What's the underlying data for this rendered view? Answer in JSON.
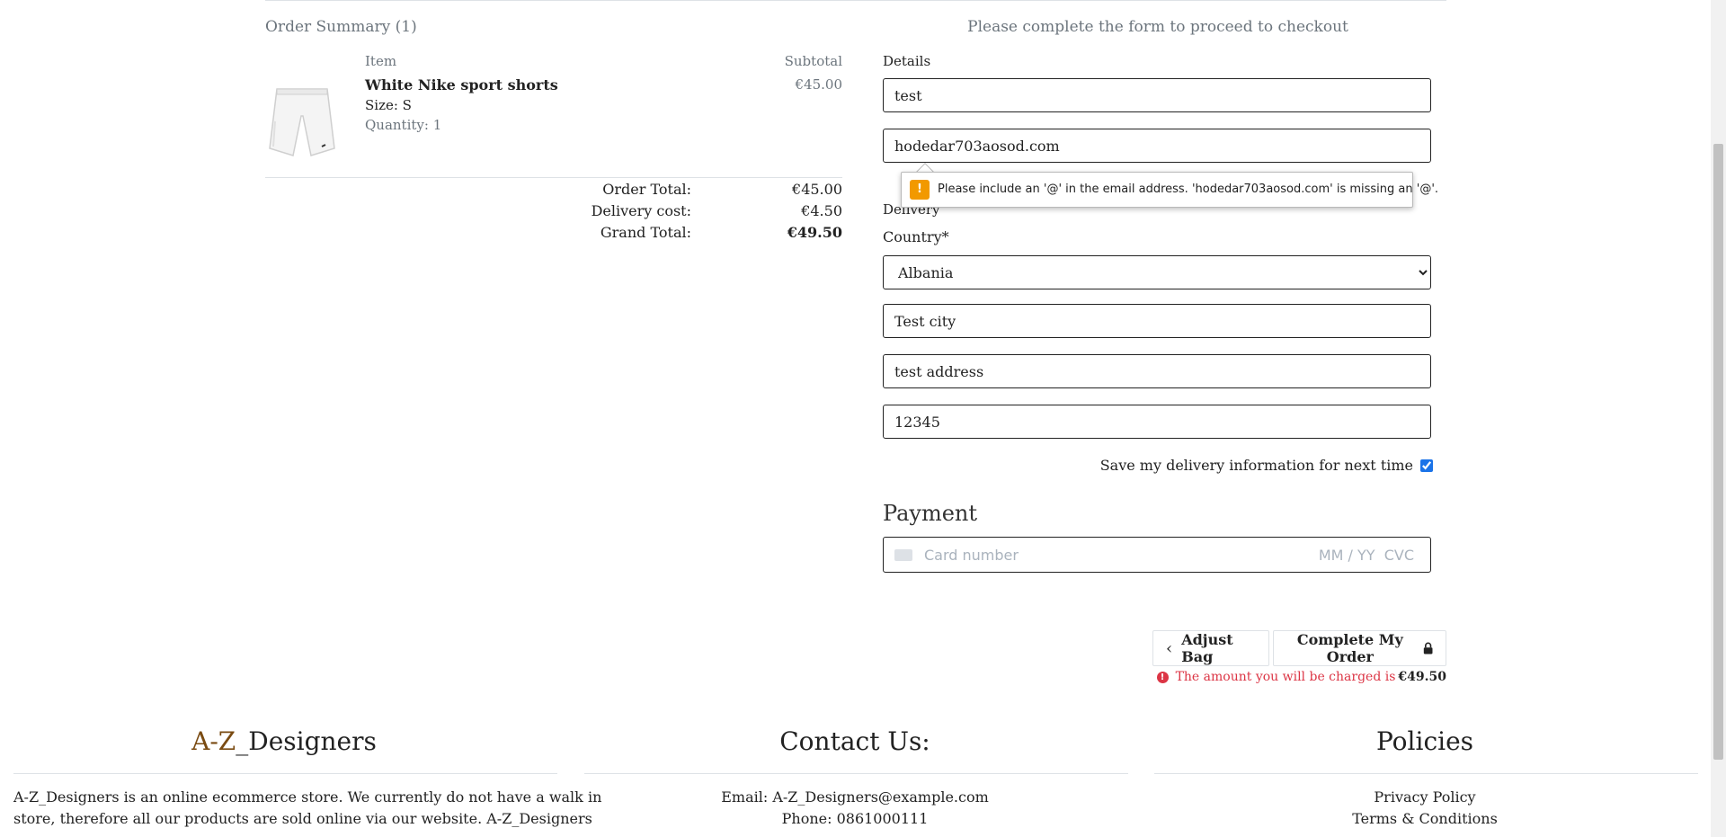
{
  "order_summary": {
    "title": "Order Summary (1)",
    "col_item": "Item",
    "col_subtotal": "Subtotal",
    "item": {
      "name": "White Nike sport shorts",
      "size": "Size: S",
      "quantity": "Quantity: 1",
      "price": "€45.00"
    },
    "totals": {
      "order_total_label": "Order Total:",
      "order_total": "€45.00",
      "delivery_label": "Delivery cost:",
      "delivery": "€4.50",
      "grand_label": "Grand Total:",
      "grand": "€49.50"
    }
  },
  "form": {
    "note": "Please complete the form to proceed to checkout",
    "details_label": "Details",
    "name_value": "test",
    "email_value": "hodedar703aosod.com",
    "tooltip": "Please include an '@' in the email address. 'hodedar703aosod.com' is missing an '@'.",
    "delivery_label": "Delivery",
    "country_label": "Country*",
    "country_value": "Albania",
    "city_value": "Test city",
    "address_value": "test address",
    "postcode_value": "12345",
    "save_info_label": "Save my delivery information for next time",
    "save_info_checked": true
  },
  "payment": {
    "title": "Payment",
    "card_placeholder": "Card number",
    "exp_cvc_placeholder": "MM / YY  CVC"
  },
  "actions": {
    "adjust_bag": "Adjust Bag",
    "complete_order": "Complete My Order",
    "charge_text": "The amount you will be charged is",
    "charge_amount": "€49.50"
  },
  "footer": {
    "brand_prefix": "A-Z",
    "brand_suffix": "_Designers",
    "brand_color": "#7a4b12",
    "about_line1": "A-Z_Designers is an online ecommerce store. We currently do not have a walk in",
    "about_line2": "store, therefore all our products are sold online via our website. A-Z_Designers",
    "contact_title": "Contact Us:",
    "email": "Email: A-Z_Designers@example.com",
    "phone": "Phone: 0861000111",
    "policies_title": "Policies",
    "privacy": "Privacy Policy",
    "terms": "Terms & Conditions"
  }
}
